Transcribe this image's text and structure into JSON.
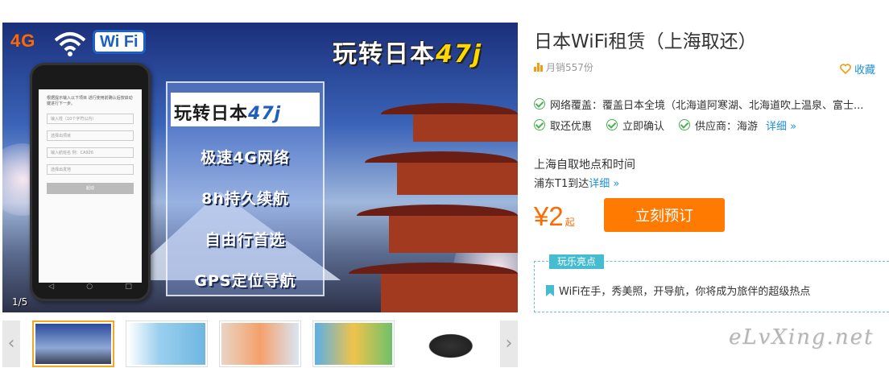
{
  "gallery": {
    "hero": {
      "badge_4g": "4G",
      "wifi_label": "Wi Fi",
      "brand_text": "玩转日本",
      "brand_num": "47",
      "brand_suffix": "j",
      "phone_screen": {
        "intro": "根据提示输入以下项目 进行使用前确认后按启动键进行下一步。",
        "field_1": "输入姓（10个字符以内）",
        "field_2": "选择出项目",
        "field_3": "输入航班名  例：CA926",
        "field_4": "选择出发地",
        "button": "起动"
      },
      "features": [
        "极速4G网络",
        "8h持久续航",
        "自由行首选",
        "GPS定位导航"
      ],
      "counter": "1/5"
    },
    "thumbs_count": 5,
    "arrow_left": "‹",
    "arrow_right": "›"
  },
  "product": {
    "title": "日本WiFi租赁（上海取还）",
    "sales": "月销557份",
    "favorite": "收藏",
    "coverage_label": "网络覆盖：覆盖日本全境（北海道阿寒湖、北海道吹上温泉、富士...",
    "badges": [
      "取还优惠",
      "立即确认",
      "供应商：海游"
    ],
    "more_label": "详细 »",
    "pickup_title": "上海自取地点和时间",
    "pickup_loc": "浦东T1到达",
    "pickup_more": "详细 »",
    "price_symbol": "¥",
    "price_value": "2",
    "price_from": "起",
    "book_button": "立刻预订",
    "highlight_tag": "玩乐亮点",
    "highlight_text": "WiFi在手，秀美照，开导航，你将成为旅伴的超级热点"
  },
  "watermark": "eLvXing.net",
  "colors": {
    "accent_orange": "#ff7a00",
    "price_orange": "#ff6a00",
    "link_blue": "#1e8fd6",
    "check_green": "#4caf50",
    "tag_cyan": "#45bcd0"
  }
}
